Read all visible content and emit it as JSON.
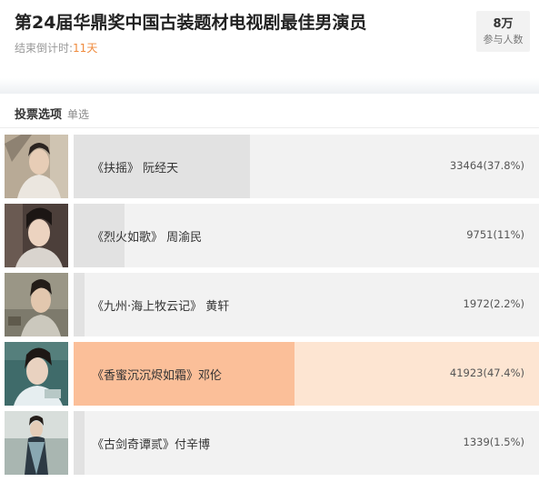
{
  "poll": {
    "title": "第24届华鼎奖中国古装题材电视剧最佳男演员",
    "countdown_label": "结束倒计时:",
    "countdown_value": "11天",
    "participants_count": "8万",
    "participants_label": "参与人数"
  },
  "section": {
    "title": "投票选项",
    "mode": "单选"
  },
  "options": [
    {
      "label": "《扶摇》 阮经天",
      "count": "33464(37.8%)",
      "share": 0.378,
      "selected": false
    },
    {
      "label": "《烈火如歌》 周渝民",
      "count": "9751(11%)",
      "share": 0.11,
      "selected": false
    },
    {
      "label": "《九州·海上牧云记》 黄轩",
      "count": "1972(2.2%)",
      "share": 0.022,
      "selected": false
    },
    {
      "label": "《香蜜沉沉烬如霜》邓伦",
      "count": "41923(47.4%)",
      "share": 0.474,
      "selected": true
    },
    {
      "label": "《古剑奇谭贰》付辛博",
      "count": "1339(1.5%)",
      "share": 0.015,
      "selected": false
    }
  ],
  "colors": {
    "accent_orange": "#f08a3c",
    "selected_fill": "#fbbf99",
    "selected_track": "#fde5d2",
    "fill_gray": "#e2e2e2",
    "track_gray": "#f2f2f2"
  }
}
